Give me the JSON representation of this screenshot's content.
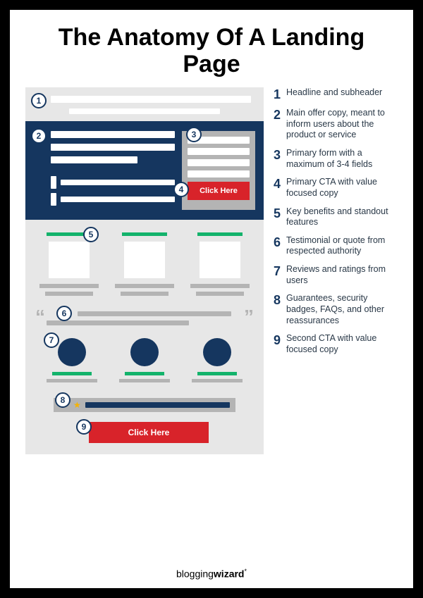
{
  "title": "The Anatomy Of A Landing Page",
  "cta_label": "Click Here",
  "cta2_label": "Click Here",
  "markers": {
    "m1": "1",
    "m2": "2",
    "m3": "3",
    "m4": "4",
    "m5": "5",
    "m6": "6",
    "m7": "7",
    "m8": "8",
    "m9": "9"
  },
  "legend": [
    {
      "n": "1",
      "text": "Headline and subheader"
    },
    {
      "n": "2",
      "text": "Main offer copy, meant to inform users about the product or service"
    },
    {
      "n": "3",
      "text": "Primary form with a maximum of 3-4 fields"
    },
    {
      "n": "4",
      "text": "Primary CTA with value focused copy"
    },
    {
      "n": "5",
      "text": "Key benefits and standout features"
    },
    {
      "n": "6",
      "text": "Testimonial or quote from respected authority"
    },
    {
      "n": "7",
      "text": "Reviews and ratings from users"
    },
    {
      "n": "8",
      "text": "Guarantees, security badges, FAQs, and other reassurances"
    },
    {
      "n": "9",
      "text": "Second CTA with value focused copy"
    }
  ],
  "footer": {
    "brand_a": "blogging",
    "brand_b": "wizard",
    "mark": "*"
  }
}
